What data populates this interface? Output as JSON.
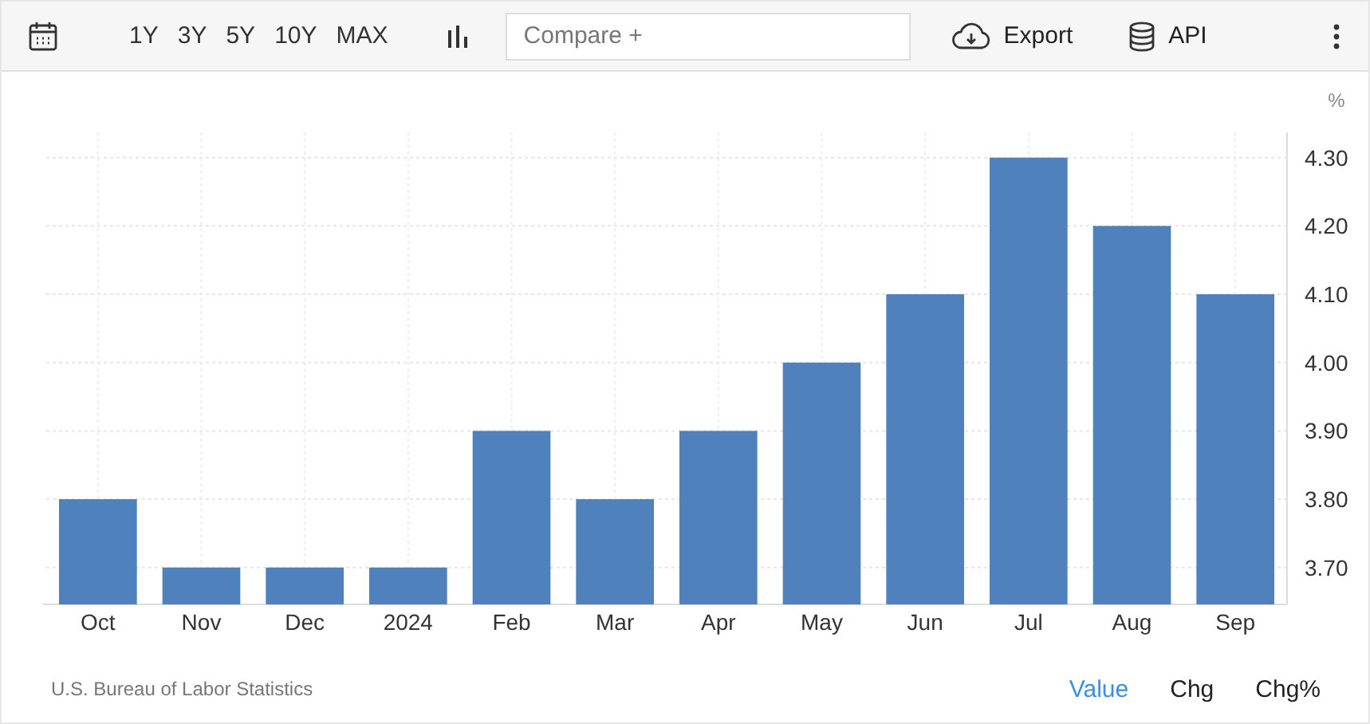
{
  "toolbar": {
    "ranges": [
      {
        "label": "1Y"
      },
      {
        "label": "3Y"
      },
      {
        "label": "5Y"
      },
      {
        "label": "10Y"
      },
      {
        "label": "MAX"
      }
    ],
    "compare": {
      "placeholder": "Compare +"
    },
    "export": "Export",
    "api": "API"
  },
  "chart": {
    "chart_data": {
      "type": "bar",
      "ylabel": "%",
      "categories": [
        "Oct",
        "Nov",
        "Dec",
        "2024",
        "Feb",
        "Mar",
        "Apr",
        "May",
        "Jun",
        "Jul",
        "Aug",
        "Sep"
      ],
      "grid": true,
      "series": [
        {
          "color": "#4f81bd",
          "values": [
            3.8,
            3.7,
            3.7,
            3.7,
            3.9,
            3.8,
            3.9,
            4.0,
            4.1,
            4.3,
            4.2,
            4.1
          ]
        }
      ],
      "ylim": [
        3.646,
        4.337
      ],
      "yticks": [
        {
          "value": 3.7,
          "label": "3.70"
        },
        {
          "value": 3.8,
          "label": "3.80"
        },
        {
          "value": 3.9,
          "label": "3.90"
        },
        {
          "value": 4.0,
          "label": "4.00"
        },
        {
          "value": 4.1,
          "label": "4.10"
        },
        {
          "value": 4.2,
          "label": "4.20"
        },
        {
          "value": 4.3,
          "label": "4.30"
        }
      ]
    }
  },
  "footer": {
    "source": "U.S. Bureau of Labor Statistics",
    "modes": [
      {
        "label": "Value",
        "selected": true
      },
      {
        "label": "Chg",
        "selected": false
      },
      {
        "label": "Chg%",
        "selected": false
      }
    ]
  }
}
